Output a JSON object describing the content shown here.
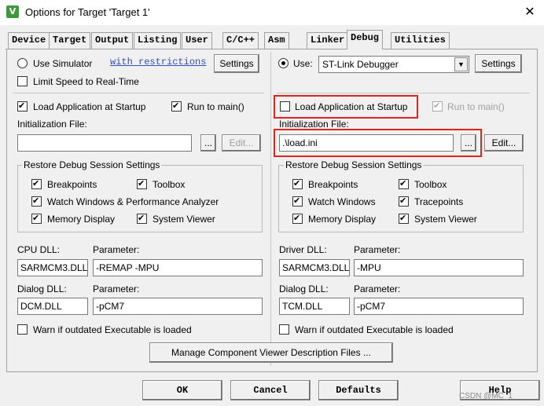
{
  "window": {
    "title": "Options for Target 'Target 1'",
    "close": "✕"
  },
  "tabs": [
    "Device",
    "Target",
    "Output",
    "Listing",
    "User",
    "C/C++",
    "Asm",
    "Linker",
    "Debug",
    "Utilities"
  ],
  "left": {
    "use_simulator": "Use Simulator",
    "with_restrictions": "with restrictions",
    "settings": "Settings",
    "limit_speed": "Limit Speed to Real-Time",
    "load_app": "Load Application at Startup",
    "run_to_main": "Run to main()",
    "init_file_label": "Initialization File:",
    "init_file_value": "",
    "browse": "...",
    "edit": "Edit...",
    "restore_title": "Restore Debug Session Settings",
    "breakpoints": "Breakpoints",
    "toolbox": "Toolbox",
    "watch_windows": "Watch Windows & Performance Analyzer",
    "memory_display": "Memory Display",
    "system_viewer": "System Viewer",
    "cpu_dll_label": "CPU DLL:",
    "cpu_dll_value": "SARMCM3.DLL",
    "parameter_label": "Parameter:",
    "cpu_param_value": "-REMAP -MPU",
    "dialog_dll_label": "Dialog DLL:",
    "dialog_dll_value": "DCM.DLL",
    "dialog_param_value": "-pCM7",
    "warn": "Warn if outdated Executable is loaded"
  },
  "right": {
    "use": "Use:",
    "debugger": "ST-Link Debugger",
    "settings": "Settings",
    "load_app": "Load Application at Startup",
    "run_to_main": "Run to main()",
    "init_file_label": "Initialization File:",
    "init_file_value": ".\\load.ini",
    "browse": "...",
    "edit": "Edit...",
    "restore_title": "Restore Debug Session Settings",
    "breakpoints": "Breakpoints",
    "toolbox": "Toolbox",
    "watch_windows": "Watch Windows",
    "tracepoints": "Tracepoints",
    "memory_display": "Memory Display",
    "system_viewer": "System Viewer",
    "driver_dll_label": "Driver DLL:",
    "driver_dll_value": "SARMCM3.DLL",
    "parameter_label": "Parameter:",
    "driver_param_value": "-MPU",
    "dialog_dll_label": "Dialog DLL:",
    "dialog_dll_value": "TCM.DLL",
    "dialog_param_value": "-pCM7",
    "warn": "Warn if outdated Executable is loaded"
  },
  "manage_button": "Manage Component Viewer Description Files ...",
  "footer": {
    "ok": "OK",
    "cancel": "Cancel",
    "defaults": "Defaults",
    "help": "Help"
  },
  "watermark": "CSDN @MC_1",
  "colors": {
    "highlight": "#e0231c",
    "link": "#3050c0"
  }
}
